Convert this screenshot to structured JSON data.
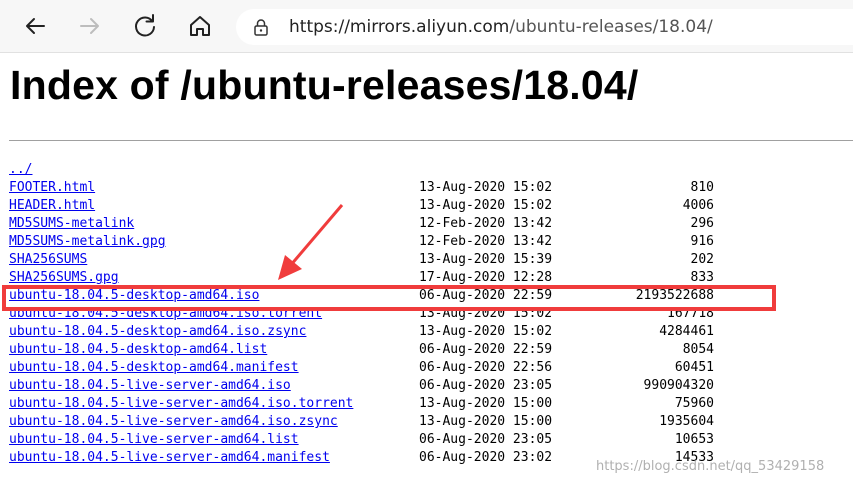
{
  "browser": {
    "url_host": "https://mirrors.aliyun.com",
    "url_path": "/ubuntu-releases/18.04/"
  },
  "page": {
    "title": "Index of /ubuntu-releases/18.04/"
  },
  "listing": {
    "rows": [
      {
        "name": "../",
        "date": "",
        "size": ""
      },
      {
        "name": "FOOTER.html",
        "date": "13-Aug-2020 15:02",
        "size": "810"
      },
      {
        "name": "HEADER.html",
        "date": "13-Aug-2020 15:02",
        "size": "4006"
      },
      {
        "name": "MD5SUMS-metalink",
        "date": "12-Feb-2020 13:42",
        "size": "296"
      },
      {
        "name": "MD5SUMS-metalink.gpg",
        "date": "12-Feb-2020 13:42",
        "size": "916"
      },
      {
        "name": "SHA256SUMS",
        "date": "13-Aug-2020 15:39",
        "size": "202"
      },
      {
        "name": "SHA256SUMS.gpg",
        "date": "17-Aug-2020 12:28",
        "size": "833"
      },
      {
        "name": "ubuntu-18.04.5-desktop-amd64.iso",
        "date": "06-Aug-2020 22:59",
        "size": "2193522688"
      },
      {
        "name": "ubuntu-18.04.5-desktop-amd64.iso.torrent",
        "date": "13-Aug-2020 15:02",
        "size": "167718"
      },
      {
        "name": "ubuntu-18.04.5-desktop-amd64.iso.zsync",
        "date": "13-Aug-2020 15:02",
        "size": "4284461"
      },
      {
        "name": "ubuntu-18.04.5-desktop-amd64.list",
        "date": "06-Aug-2020 22:59",
        "size": "8054"
      },
      {
        "name": "ubuntu-18.04.5-desktop-amd64.manifest",
        "date": "06-Aug-2020 22:56",
        "size": "60451"
      },
      {
        "name": "ubuntu-18.04.5-live-server-amd64.iso",
        "date": "06-Aug-2020 23:05",
        "size": "990904320"
      },
      {
        "name": "ubuntu-18.04.5-live-server-amd64.iso.torrent",
        "date": "13-Aug-2020 15:00",
        "size": "75960"
      },
      {
        "name": "ubuntu-18.04.5-live-server-amd64.iso.zsync",
        "date": "13-Aug-2020 15:00",
        "size": "1935604"
      },
      {
        "name": "ubuntu-18.04.5-live-server-amd64.list",
        "date": "06-Aug-2020 23:05",
        "size": "10653"
      },
      {
        "name": "ubuntu-18.04.5-live-server-amd64.manifest",
        "date": "06-Aug-2020 23:02",
        "size": "14533"
      }
    ]
  },
  "annotation": {
    "highlight_color": "#f03c3c",
    "highlighted_file": "ubuntu-18.04.5-desktop-amd64.iso"
  },
  "watermark": {
    "text": "https://blog.csdn.net/qq_53429158"
  }
}
